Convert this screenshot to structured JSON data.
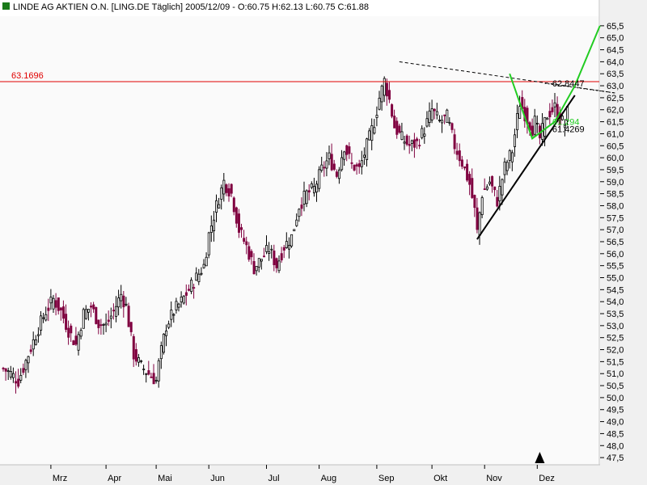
{
  "header": {
    "title": "LINDE AG AKTIEN O.N. [LING.DE  Täglich] 2005/12/09 - O:60.75 H:62.13 L:60.75 C:61.88"
  },
  "colors": {
    "background": "#FFFFFF",
    "plot_background": "#FAFAFA",
    "axis_panel": "#F0F0F0",
    "up_candle": "#000000",
    "down_candle": "#800040",
    "resistance_line": "#E00000",
    "trend_line": "#000000",
    "green_line": "#22CC22"
  },
  "chart_data": {
    "type": "candlestick",
    "ylim": [
      47.2,
      65.9
    ],
    "y_ticks": [
      "47,5",
      "48,0",
      "48,5",
      "49,0",
      "49,5",
      "50,0",
      "50,5",
      "51,0",
      "51,5",
      "52,0",
      "52,5",
      "53,0",
      "53,5",
      "54,0",
      "54,5",
      "55,0",
      "55,5",
      "56,0",
      "56,5",
      "57,0",
      "57,5",
      "58,0",
      "58,5",
      "59,0",
      "59,5",
      "60,0",
      "60,5",
      "61,0",
      "61,5",
      "62,0",
      "62,5",
      "63,0",
      "63,5",
      "64,0",
      "64,5",
      "65,0",
      "65,5"
    ],
    "months": [
      {
        "label": "Mrz",
        "day": 19
      },
      {
        "label": "Apr",
        "day": 41
      },
      {
        "label": "Mai",
        "day": 61
      },
      {
        "label": "Jun",
        "day": 82
      },
      {
        "label": "Jul",
        "day": 105
      },
      {
        "label": "Aug",
        "day": 126
      },
      {
        "label": "Sep",
        "day": 149
      },
      {
        "label": "Okt",
        "day": 171
      },
      {
        "label": "Nov",
        "day": 192
      },
      {
        "label": "Dez",
        "day": 213
      }
    ],
    "keypoints": [
      [
        0,
        51.2
      ],
      [
        3,
        51.0
      ],
      [
        6,
        50.7
      ],
      [
        10,
        51.8
      ],
      [
        14,
        52.9
      ],
      [
        17,
        53.6
      ],
      [
        20,
        54.1
      ],
      [
        23,
        53.6
      ],
      [
        26,
        52.8
      ],
      [
        29,
        52.2
      ],
      [
        32,
        53.5
      ],
      [
        35,
        53.8
      ],
      [
        38,
        53.1
      ],
      [
        41,
        53.0
      ],
      [
        44,
        53.6
      ],
      [
        47,
        54.3
      ],
      [
        49,
        53.8
      ],
      [
        52,
        51.8
      ],
      [
        55,
        51.3
      ],
      [
        58,
        51.0
      ],
      [
        61,
        50.7
      ],
      [
        62,
        51.4
      ],
      [
        65,
        53.0
      ],
      [
        68,
        53.6
      ],
      [
        71,
        54.0
      ],
      [
        74,
        54.5
      ],
      [
        77,
        55.0
      ],
      [
        80,
        55.5
      ],
      [
        82,
        56.8
      ],
      [
        85,
        58.0
      ],
      [
        88,
        59.0
      ],
      [
        91,
        58.5
      ],
      [
        94,
        57.0
      ],
      [
        97,
        56.3
      ],
      [
        100,
        55.4
      ],
      [
        103,
        55.8
      ],
      [
        106,
        56.2
      ],
      [
        109,
        55.5
      ],
      [
        112,
        56.3
      ],
      [
        115,
        56.7
      ],
      [
        118,
        58.0
      ],
      [
        121,
        58.5
      ],
      [
        124,
        58.7
      ],
      [
        127,
        59.5
      ],
      [
        130,
        60.0
      ],
      [
        133,
        59.3
      ],
      [
        136,
        60.5
      ],
      [
        139,
        59.7
      ],
      [
        142,
        59.5
      ],
      [
        145,
        60.5
      ],
      [
        148,
        61.5
      ],
      [
        150,
        62.5
      ],
      [
        152,
        63.2
      ],
      [
        154,
        62.4
      ],
      [
        156,
        61.3
      ],
      [
        159,
        60.8
      ],
      [
        162,
        60.5
      ],
      [
        165,
        60.6
      ],
      [
        168,
        61.2
      ],
      [
        171,
        62.0
      ],
      [
        174,
        61.5
      ],
      [
        177,
        61.7
      ],
      [
        180,
        60.5
      ],
      [
        183,
        59.8
      ],
      [
        186,
        58.9
      ],
      [
        188,
        57.8
      ],
      [
        189,
        56.9
      ],
      [
        191,
        58.5
      ],
      [
        194,
        59.0
      ],
      [
        197,
        58.2
      ],
      [
        200,
        59.6
      ],
      [
        203,
        60.3
      ],
      [
        206,
        62.3
      ],
      [
        209,
        61.6
      ],
      [
        211,
        61.2
      ],
      [
        212,
        61.5
      ],
      [
        214,
        60.8
      ],
      [
        217,
        61.8
      ],
      [
        220,
        62.1
      ],
      [
        222,
        61.6
      ],
      [
        224,
        61.4
      ],
      [
        225,
        61.9
      ]
    ],
    "lines": {
      "resistance": {
        "label": "63.1696",
        "value": 63.1696
      },
      "descending_trend": {
        "from": [
          158,
          64.0
        ],
        "to": [
          244,
          62.7
        ]
      },
      "dotted_small": {
        "from": [
          216,
          63.1
        ],
        "to": [
          244,
          62.7
        ]
      },
      "ascending_trend": {
        "from": [
          189,
          56.6
        ],
        "to": [
          228,
          62.6
        ]
      },
      "green_projection": {
        "points": [
          [
            202,
            63.5
          ],
          [
            207,
            62.0
          ],
          [
            211,
            60.8
          ],
          [
            220,
            61.5
          ],
          [
            228,
            63.0
          ],
          [
            238,
            65.5
          ]
        ]
      }
    },
    "labels": [
      {
        "text": "62.8447",
        "day": 219,
        "y": 63.1,
        "color": "#000000"
      },
      {
        "text": "61.294",
        "day": 219,
        "y": 61.5,
        "color": "#22CC22"
      },
      {
        "text": "61.4269",
        "day": 219,
        "y": 61.2,
        "color": "#000000"
      }
    ],
    "marker_day": 214
  }
}
